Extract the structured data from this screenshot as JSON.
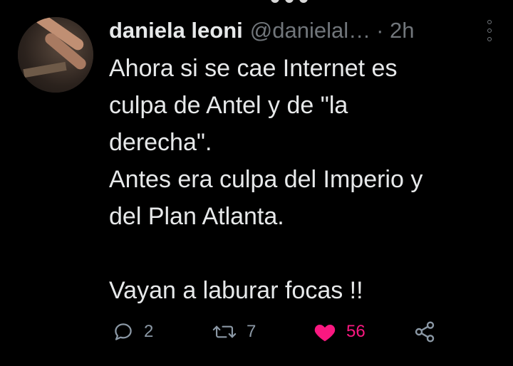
{
  "tweet": {
    "author": {
      "display_name": "daniela leoni",
      "handle": "@danielal…",
      "time": "· 2h"
    },
    "body_lines": [
      "Ahora si se cae Internet es",
      "culpa de Antel y de \"la",
      "derecha\".",
      "Antes era culpa del Imperio y",
      "del Plan Atlanta.",
      "",
      "Vayan a laburar focas  !!"
    ],
    "stats": {
      "replies": "2",
      "retweets": "7",
      "likes": "56"
    }
  },
  "colors": {
    "background": "#000000",
    "text": "#e7e9ea",
    "muted": "#71767b",
    "like": "#f91880",
    "icon": "#8b98a5"
  },
  "icons": [
    "more-vertical-icon",
    "reply-icon",
    "retweet-icon",
    "heart-icon",
    "share-icon"
  ]
}
